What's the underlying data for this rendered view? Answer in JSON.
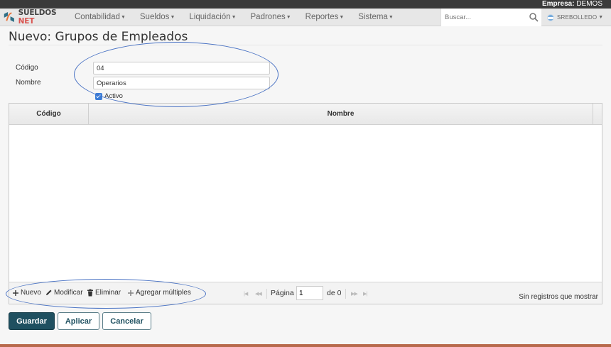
{
  "header": {
    "empresa_label": "Empresa:",
    "empresa_value": " DEMOS",
    "brand_main": "SUELDOS",
    "brand_accent": " NET",
    "menu": [
      {
        "label": "Contabilidad"
      },
      {
        "label": "Sueldos"
      },
      {
        "label": "Liquidación"
      },
      {
        "label": "Padrones"
      },
      {
        "label": "Reportes"
      },
      {
        "label": "Sistema"
      }
    ],
    "search_placeholder": "Buscar...",
    "user": "SREBOLLEDO"
  },
  "page": {
    "title": "Nuevo: Grupos de Empleados"
  },
  "form": {
    "codigo_label": "Código",
    "codigo_value": "04",
    "nombre_label": "Nombre",
    "nombre_value": "Operarios",
    "activo_label": "Activo",
    "activo_checked": true
  },
  "grid": {
    "columns": [
      "Código",
      "Nombre"
    ],
    "rows": [],
    "toolbar": {
      "nuevo": "Nuevo",
      "modificar": "Modificar",
      "eliminar": "Eliminar",
      "agregar_multiples": "Agregar múltiples"
    },
    "pager": {
      "pagina_label": "Página",
      "page_value": "1",
      "de_label": "de 0",
      "status": "Sin registros que mostrar"
    }
  },
  "buttons": {
    "guardar": "Guardar",
    "aplicar": "Aplicar",
    "cancelar": "Cancelar"
  },
  "colors": {
    "primary": "#1f5060",
    "annotation": "#4a73c4",
    "brand_accent": "#d9534f"
  }
}
